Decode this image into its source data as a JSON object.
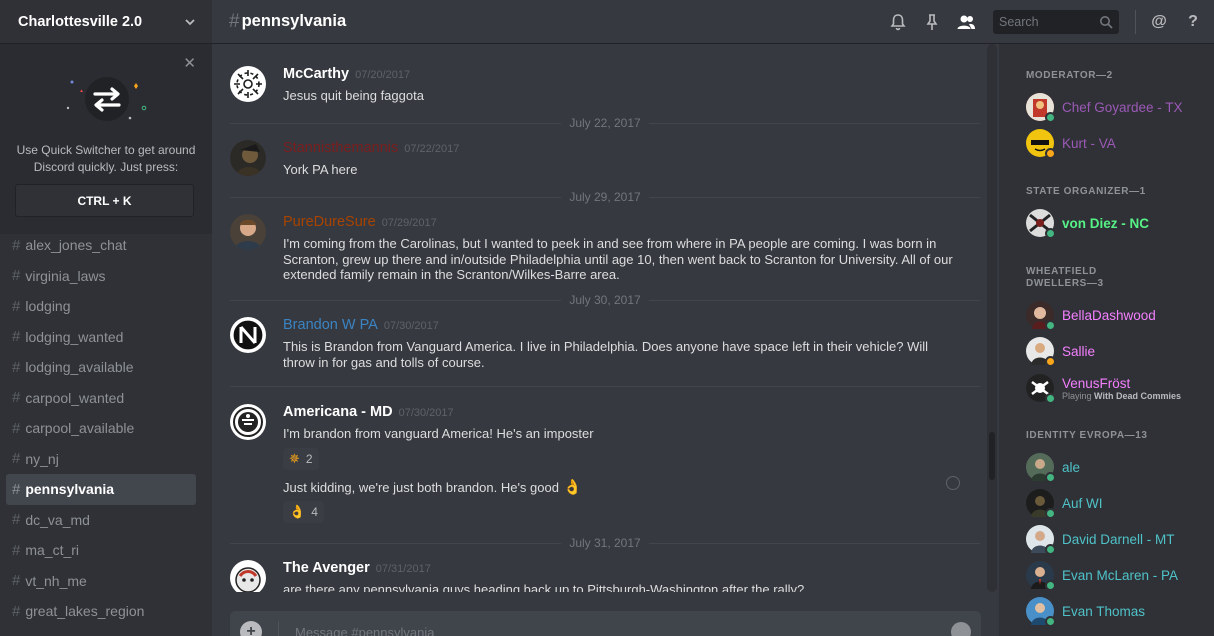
{
  "app": {
    "server_name": "Charlottesville 2.0",
    "channel_hash": "#",
    "channel_name": "pennsylvania"
  },
  "quick_switcher": {
    "close_icon": "close-icon",
    "line1": "Use Quick Switcher to get around",
    "line2": "Discord quickly. Just press:",
    "shortcut": "CTRL + K"
  },
  "channels": [
    {
      "name": "alex_jones_chat",
      "active": false
    },
    {
      "name": "virginia_laws",
      "active": false
    },
    {
      "name": "lodging",
      "active": false
    },
    {
      "name": "lodging_wanted",
      "active": false
    },
    {
      "name": "lodging_available",
      "active": false
    },
    {
      "name": "carpool_wanted",
      "active": false
    },
    {
      "name": "carpool_available",
      "active": false
    },
    {
      "name": "ny_nj",
      "active": false
    },
    {
      "name": "pennsylvania",
      "active": true
    },
    {
      "name": "dc_va_md",
      "active": false
    },
    {
      "name": "ma_ct_ri",
      "active": false
    },
    {
      "name": "vt_nh_me",
      "active": false
    },
    {
      "name": "great_lakes_region",
      "active": false
    }
  ],
  "header": {
    "search_placeholder": "Search",
    "icons": [
      "bell-icon",
      "pin-icon",
      "members-icon",
      "search-icon",
      "mention-icon",
      "help-icon"
    ],
    "mention": "@",
    "help": "?"
  },
  "dates": {
    "d1": "July 22, 2017",
    "d2": "July 29, 2017",
    "d3": "July 30, 2017",
    "d4": "July 31, 2017"
  },
  "messages": [
    {
      "user": "McCarthy",
      "color": "#ffffff",
      "time": "07/20/2017",
      "text": "Jesus quit being faggota"
    },
    {
      "user": "Stannisthemannis",
      "color": "#7a1e1e",
      "time": "07/22/2017",
      "text": "York PA here"
    },
    {
      "user": "PureDureSure",
      "color": "#a84300",
      "time": "07/29/2017",
      "text": "I'm coming from the Carolinas, but I wanted to peek in and see from where in PA people are coming. I was born in Scranton, grew up there and in/outside Philadelphia until age 10, then went back to Scranton for University. All of our extended family remain in the Scranton/Wilkes-Barre area."
    },
    {
      "user": "Brandon W PA",
      "color": "#3b84c4",
      "time": "07/30/2017",
      "text": "This is Brandon from Vanguard America. I live in Philadelphia. Does anyone have space left  in their vehicle? Will throw in for gas and tolls of course."
    },
    {
      "user": "Americana - MD",
      "color": "#ffffff",
      "time": "07/30/2017",
      "text": "I'm brandon from vanguard America! He's an imposter",
      "reaction_count": "2",
      "text2": "Just kidding, we're just both brandon. He's good",
      "reaction2_count": "4"
    },
    {
      "user": "The Avenger",
      "color": "#ffffff",
      "time": "07/31/2017",
      "text": "are there any pennsylvania guys heading back up to Pittsburgh-Washington after the rally?"
    }
  ],
  "composer": {
    "placeholder": "Message #pennsylvania"
  },
  "members": {
    "categories": {
      "moderator": "MODERATOR—2",
      "state_organizer": "STATE ORGANIZER—1",
      "wheatfield_1": "WHEATFIELD",
      "wheatfield_2": "DWELLERS—3",
      "identity": "IDENTITY EVROPA—13"
    },
    "list": [
      {
        "name": "Chef Goyardee - TX",
        "color": "#9b59b6",
        "status": "#43b581"
      },
      {
        "name": "Kurt - VA",
        "color": "#9b59b6",
        "status": "#faa61a"
      },
      {
        "name": "von Diez - NC",
        "color": "#57f287",
        "status": "#43b581"
      },
      {
        "name": "BellaDashwood",
        "color": "#f47fff",
        "status": "#43b581"
      },
      {
        "name": "Sallie",
        "color": "#f47fff",
        "status": "#faa61a"
      },
      {
        "name": "VenusFröst",
        "color": "#f47fff",
        "status": "#43b581",
        "activity_prefix": "Playing",
        "activity": "With Dead Commies"
      },
      {
        "name": "ale",
        "color": "#4fc2c8",
        "status": "#43b581"
      },
      {
        "name": "Auf WI",
        "color": "#4fc2c8",
        "status": "#43b581"
      },
      {
        "name": "David Darnell - MT",
        "color": "#4fc2c8",
        "status": "#43b581"
      },
      {
        "name": "Evan McLaren - PA",
        "color": "#4fc2c8",
        "status": "#43b581"
      },
      {
        "name": "Evan Thomas",
        "color": "#4fc2c8",
        "status": "#43b581"
      }
    ]
  }
}
